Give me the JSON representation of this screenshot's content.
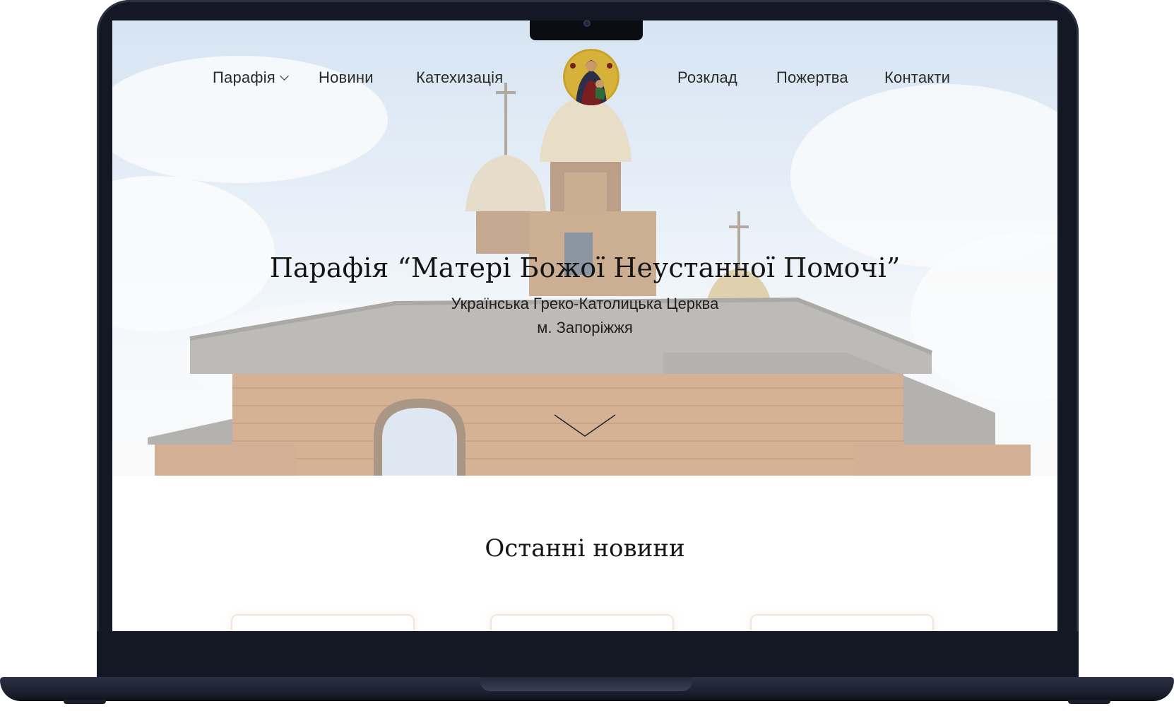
{
  "nav": {
    "items": [
      {
        "label": "Парафія",
        "has_dropdown": true
      },
      {
        "label": "Новини"
      },
      {
        "label": "Катехизація"
      },
      {
        "label": "Розклад"
      },
      {
        "label": "Пожертва"
      },
      {
        "label": "Контакти"
      }
    ],
    "logo_icon": "icon-of-mother-of-perpetual-help"
  },
  "hero": {
    "title": "Парафія “Матері Божої Неустанної Помочі”",
    "subtitle_line1": "Українська Греко-Католицька Церква",
    "subtitle_line2": "м. Запоріжжя",
    "scroll_icon": "chevron-down-icon"
  },
  "news": {
    "heading": "Останні новини",
    "card_count_visible": 3
  },
  "colors": {
    "text": "#151515",
    "card_border": "#f4e4da",
    "frame": "#141824"
  }
}
